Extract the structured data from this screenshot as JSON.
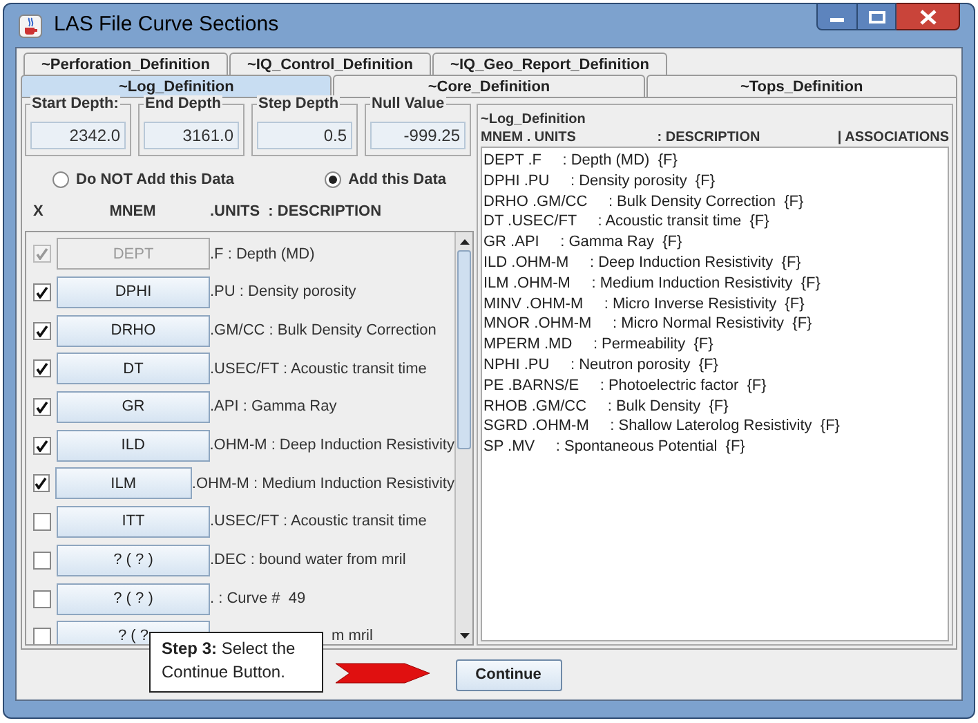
{
  "window": {
    "title": "LAS File Curve Sections"
  },
  "tabs_top": [
    {
      "label": "~Perforation_Definition",
      "selected": false
    },
    {
      "label": "~IQ_Control_Definition",
      "selected": false
    },
    {
      "label": "~IQ_Geo_Report_Definition",
      "selected": false
    }
  ],
  "tabs_bottom": [
    {
      "label": "~Log_Definition",
      "selected": true
    },
    {
      "label": "~Core_Definition",
      "selected": false
    },
    {
      "label": "~Tops_Definition",
      "selected": false
    }
  ],
  "depth_fields": [
    {
      "label": "Start Depth:",
      "value": "2342.0"
    },
    {
      "label": "End Depth",
      "value": "3161.0"
    },
    {
      "label": "Step Depth",
      "value": "0.5"
    },
    {
      "label": "Null Value",
      "value": "-999.25"
    }
  ],
  "add_options": [
    {
      "label": "Do NOT Add this Data",
      "selected": false
    },
    {
      "label": "Add this Data",
      "selected": true
    }
  ],
  "curve_list": {
    "columns": [
      "X",
      "MNEM",
      ".UNITS  : DESCRIPTION"
    ],
    "rows": [
      {
        "checked": true,
        "disabled": true,
        "mnem": "DEPT",
        "description": ".F : Depth (MD)"
      },
      {
        "checked": true,
        "disabled": false,
        "mnem": "DPHI",
        "description": ".PU : Density porosity"
      },
      {
        "checked": true,
        "disabled": false,
        "mnem": "DRHO",
        "description": ".GM/CC : Bulk Density Correction"
      },
      {
        "checked": true,
        "disabled": false,
        "mnem": "DT",
        "description": ".USEC/FT : Acoustic transit time"
      },
      {
        "checked": true,
        "disabled": false,
        "mnem": "GR",
        "description": ".API : Gamma Ray"
      },
      {
        "checked": true,
        "disabled": false,
        "mnem": "ILD",
        "description": ".OHM-M : Deep Induction Resistivity"
      },
      {
        "checked": true,
        "disabled": false,
        "mnem": "ILM",
        "description": ".OHM-M : Medium Induction Resistivity"
      },
      {
        "checked": false,
        "disabled": false,
        "mnem": "ITT",
        "description": ".USEC/FT : Acoustic transit time"
      },
      {
        "checked": false,
        "disabled": false,
        "mnem": "? ( ? )",
        "description": ".DEC : bound water from mril"
      },
      {
        "checked": false,
        "disabled": false,
        "mnem": "? ( ? )",
        "description": ". : Curve #  49"
      },
      {
        "checked": false,
        "disabled": false,
        "mnem": "? ( ?",
        "description": "m mril",
        "covered": true
      }
    ]
  },
  "definition": {
    "title": "~Log_Definition",
    "columns": [
      "MNEM . UNITS",
      ": DESCRIPTION",
      "| ASSOCIATIONS"
    ],
    "lines": [
      "DEPT .F     : Depth (MD)  {F}",
      "DPHI .PU     : Density porosity  {F}",
      "DRHO .GM/CC     : Bulk Density Correction  {F}",
      "DT .USEC/FT     : Acoustic transit time  {F}",
      "GR .API     : Gamma Ray  {F}",
      "ILD .OHM-M     : Deep Induction Resistivity  {F}",
      "ILM .OHM-M     : Medium Induction Resistivity  {F}",
      "MINV .OHM-M     : Micro Inverse Resistivity  {F}",
      "MNOR .OHM-M     : Micro Normal Resistivity  {F}",
      "MPERM .MD     : Permeability  {F}",
      "NPHI .PU     : Neutron porosity  {F}",
      "PE .BARNS/E     : Photoelectric factor  {F}",
      "RHOB .GM/CC     : Bulk Density  {F}",
      "SGRD .OHM-M     : Shallow Laterolog Resistivity  {F}",
      "SP .MV     : Spontaneous Potential  {F}"
    ]
  },
  "callout": {
    "text": "**Step 3:** Select the Continue Button."
  },
  "continue_button": "Continue"
}
